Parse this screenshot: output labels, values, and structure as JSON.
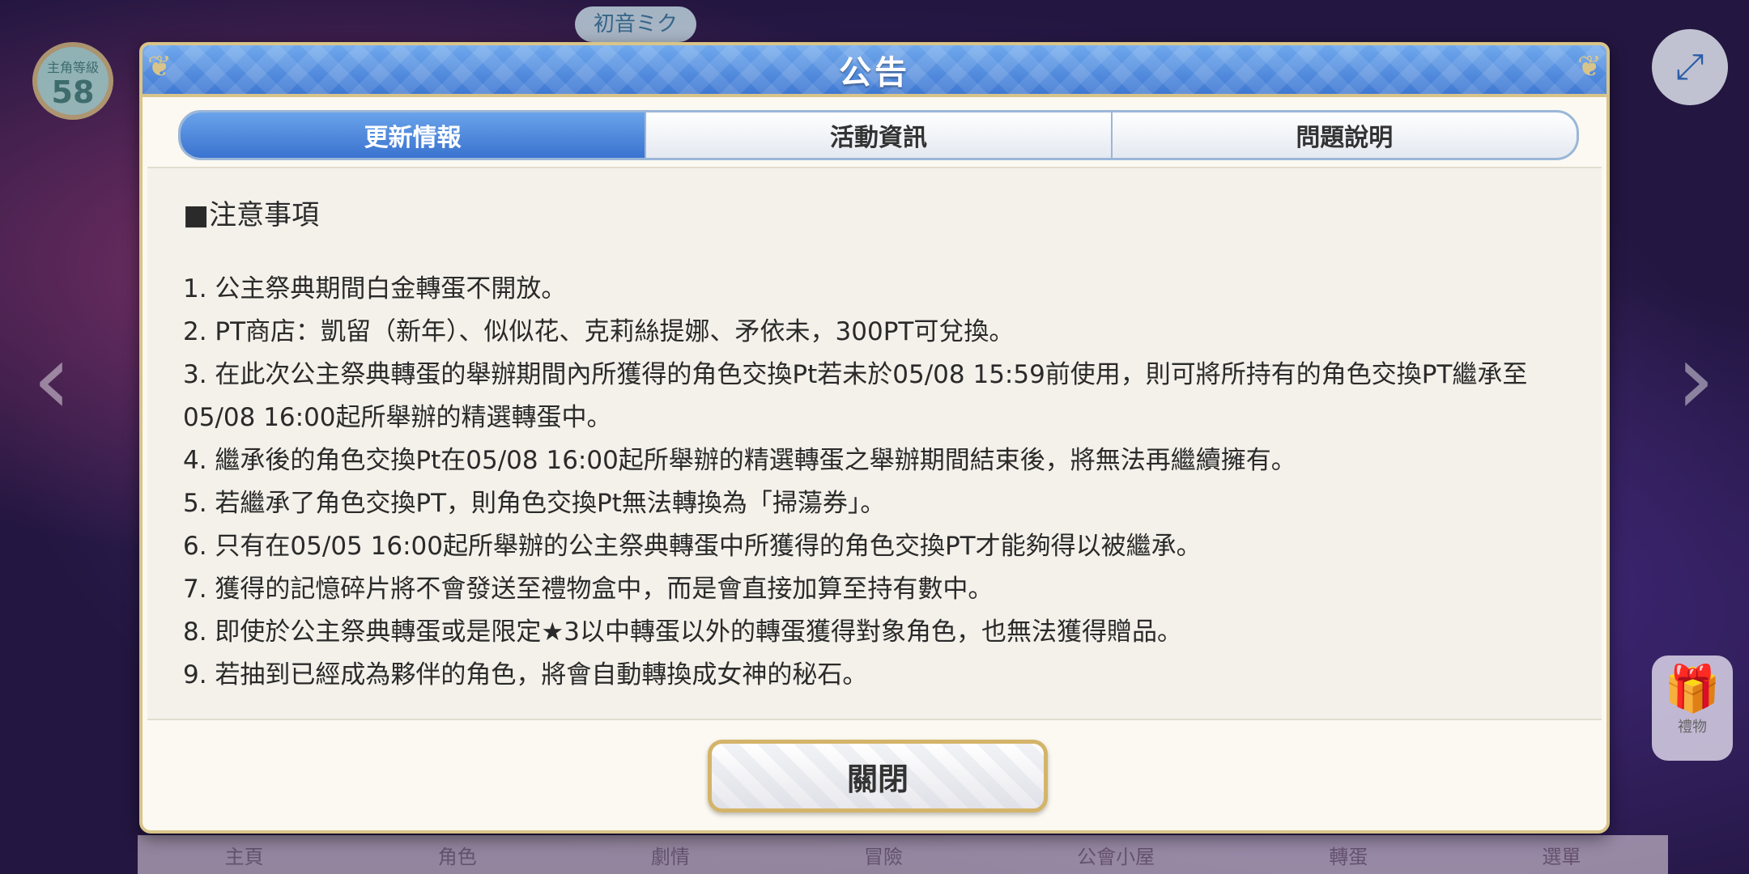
{
  "background": {
    "level_label": "主角等級",
    "level_value": "58",
    "miku_badge": "初音ミク",
    "gift_label": "禮物",
    "nav_items": [
      "主頁",
      "角色",
      "劇情",
      "冒險",
      "公會小屋",
      "轉蛋",
      "選單"
    ]
  },
  "dialog": {
    "title": "公告",
    "tabs": [
      {
        "label": "更新情報",
        "active": true
      },
      {
        "label": "活動資訊",
        "active": false
      },
      {
        "label": "問題說明",
        "active": false
      }
    ],
    "section_heading": "■注意事項",
    "lines": [
      "1. 公主祭典期間白金轉蛋不開放。",
      "2. PT商店：凱留（新年）、似似花、克莉絲提娜、矛依未，300PT可兌換。",
      "3. 在此次公主祭典轉蛋的舉辦期間內所獲得的角色交換Pt若未於05/08 15:59前使用，則可將所持有的角色交換PT繼承至05/08 16:00起所舉辦的精選轉蛋中。",
      "4. 繼承後的角色交換Pt在05/08 16:00起所舉辦的精選轉蛋之舉辦期間結束後，將無法再繼續擁有。",
      "5. 若繼承了角色交換PT，則角色交換Pt無法轉換為「掃蕩券」。",
      "6. 只有在05/05 16:00起所舉辦的公主祭典轉蛋中所獲得的角色交換PT才能夠得以被繼承。",
      "7. 獲得的記憶碎片將不會發送至禮物盒中，而是會直接加算至持有數中。",
      "8. 即使於公主祭典轉蛋或是限定★3以中轉蛋以外的轉蛋獲得對象角色，也無法獲得贈品。",
      "9. 若抽到已經成為夥伴的角色，將會自動轉換成女神的秘石。"
    ],
    "close_label": "關閉"
  }
}
